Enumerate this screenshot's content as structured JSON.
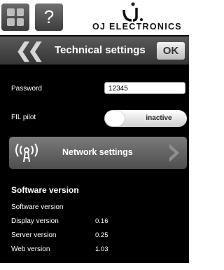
{
  "header": {
    "grid_icon": "grid-icon",
    "help_label": "?",
    "logo_text": "OJ ELECTRONICS"
  },
  "titlebar": {
    "title": "Technical settings",
    "back_icon": "double-chevron-left-icon",
    "ok_label": "OK"
  },
  "settings": {
    "password_label": "Password",
    "password_value": "12345",
    "fil_pilot_label": "FIL pilot",
    "fil_pilot_value": "inactive",
    "network_label": "Network settings"
  },
  "software": {
    "section_title": "Software version",
    "rows": [
      {
        "label": "Software version",
        "value": ""
      },
      {
        "label": "Display version",
        "value": "0.16"
      },
      {
        "label": "Server version",
        "value": "0.25"
      },
      {
        "label": "Web version",
        "value": "1.03"
      }
    ]
  },
  "colors": {
    "background": "#000000",
    "titlebar": "#4a4a4a",
    "button": "#666666"
  }
}
